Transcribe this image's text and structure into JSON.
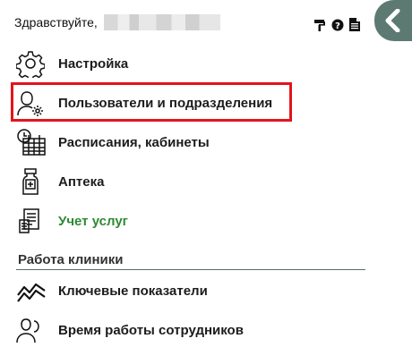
{
  "header": {
    "greeting": "Здравствуйте,",
    "icons": [
      "paint-roller-icon",
      "help-circle-icon",
      "document-icon"
    ]
  },
  "menu": {
    "items": [
      {
        "label": "Настройка",
        "icon": "gear-icon"
      },
      {
        "label": "Пользователи и подразделения",
        "icon": "user-gear-icon",
        "highlighted": true
      },
      {
        "label": "Расписания, кабинеты",
        "icon": "calendar-clock-icon"
      },
      {
        "label": "Аптека",
        "icon": "medicine-bottle-icon"
      },
      {
        "label": "Учет услуг",
        "icon": "receipt-icon",
        "color": "#2d8a33"
      }
    ]
  },
  "section": {
    "title": "Работа клиники",
    "items": [
      {
        "label": "Ключевые показатели",
        "icon": "trend-line-icon"
      },
      {
        "label": "Время работы сотрудников",
        "icon": "users-icon"
      }
    ]
  },
  "colors": {
    "accent": "#5d7a72",
    "highlight": "#e3141b",
    "green": "#2d8a33"
  }
}
